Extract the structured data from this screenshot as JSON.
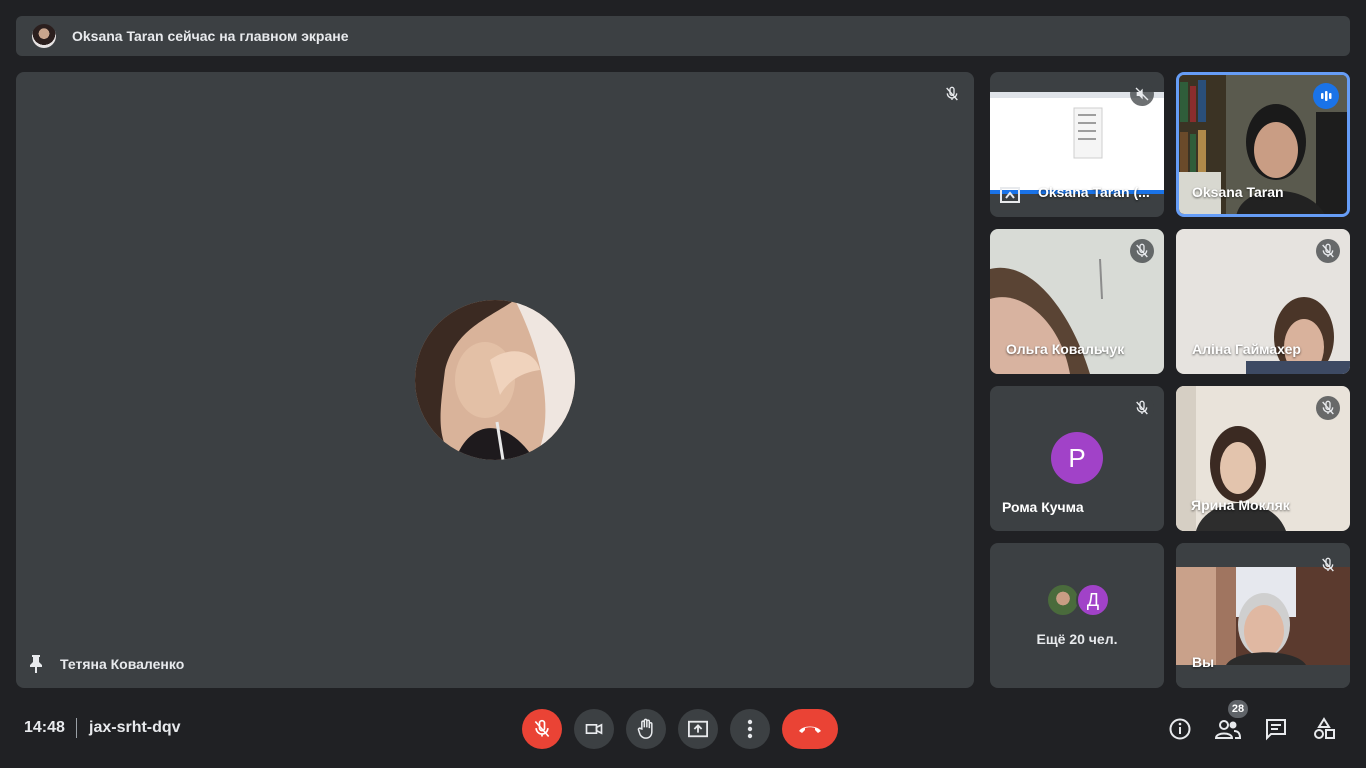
{
  "banner": {
    "text": "Oksana Taran сейчас на главном экране"
  },
  "main": {
    "name": "Тетяна Коваленко"
  },
  "tiles": [
    {
      "label": "Oksana Taran (..."
    },
    {
      "label": "Oksana Taran"
    },
    {
      "label": "Ольга Ковальчук"
    },
    {
      "label": "Аліна Гаймахер"
    },
    {
      "label": "Рома Кучма",
      "avatar_letter": "Р"
    },
    {
      "label": "Ярина Мокляк"
    },
    {
      "label": "Ещё 20 чел.",
      "avatar_letter": "Д"
    },
    {
      "label": "Вы"
    }
  ],
  "bottom": {
    "time": "14:48",
    "meeting_code": "jax-srht-dqv",
    "participants_count": "28"
  },
  "colors": {
    "background": "#202124",
    "tile": "#3c4043",
    "danger": "#ea4335",
    "speaking": "#669df6",
    "avatar_purple": "#a142c8"
  }
}
